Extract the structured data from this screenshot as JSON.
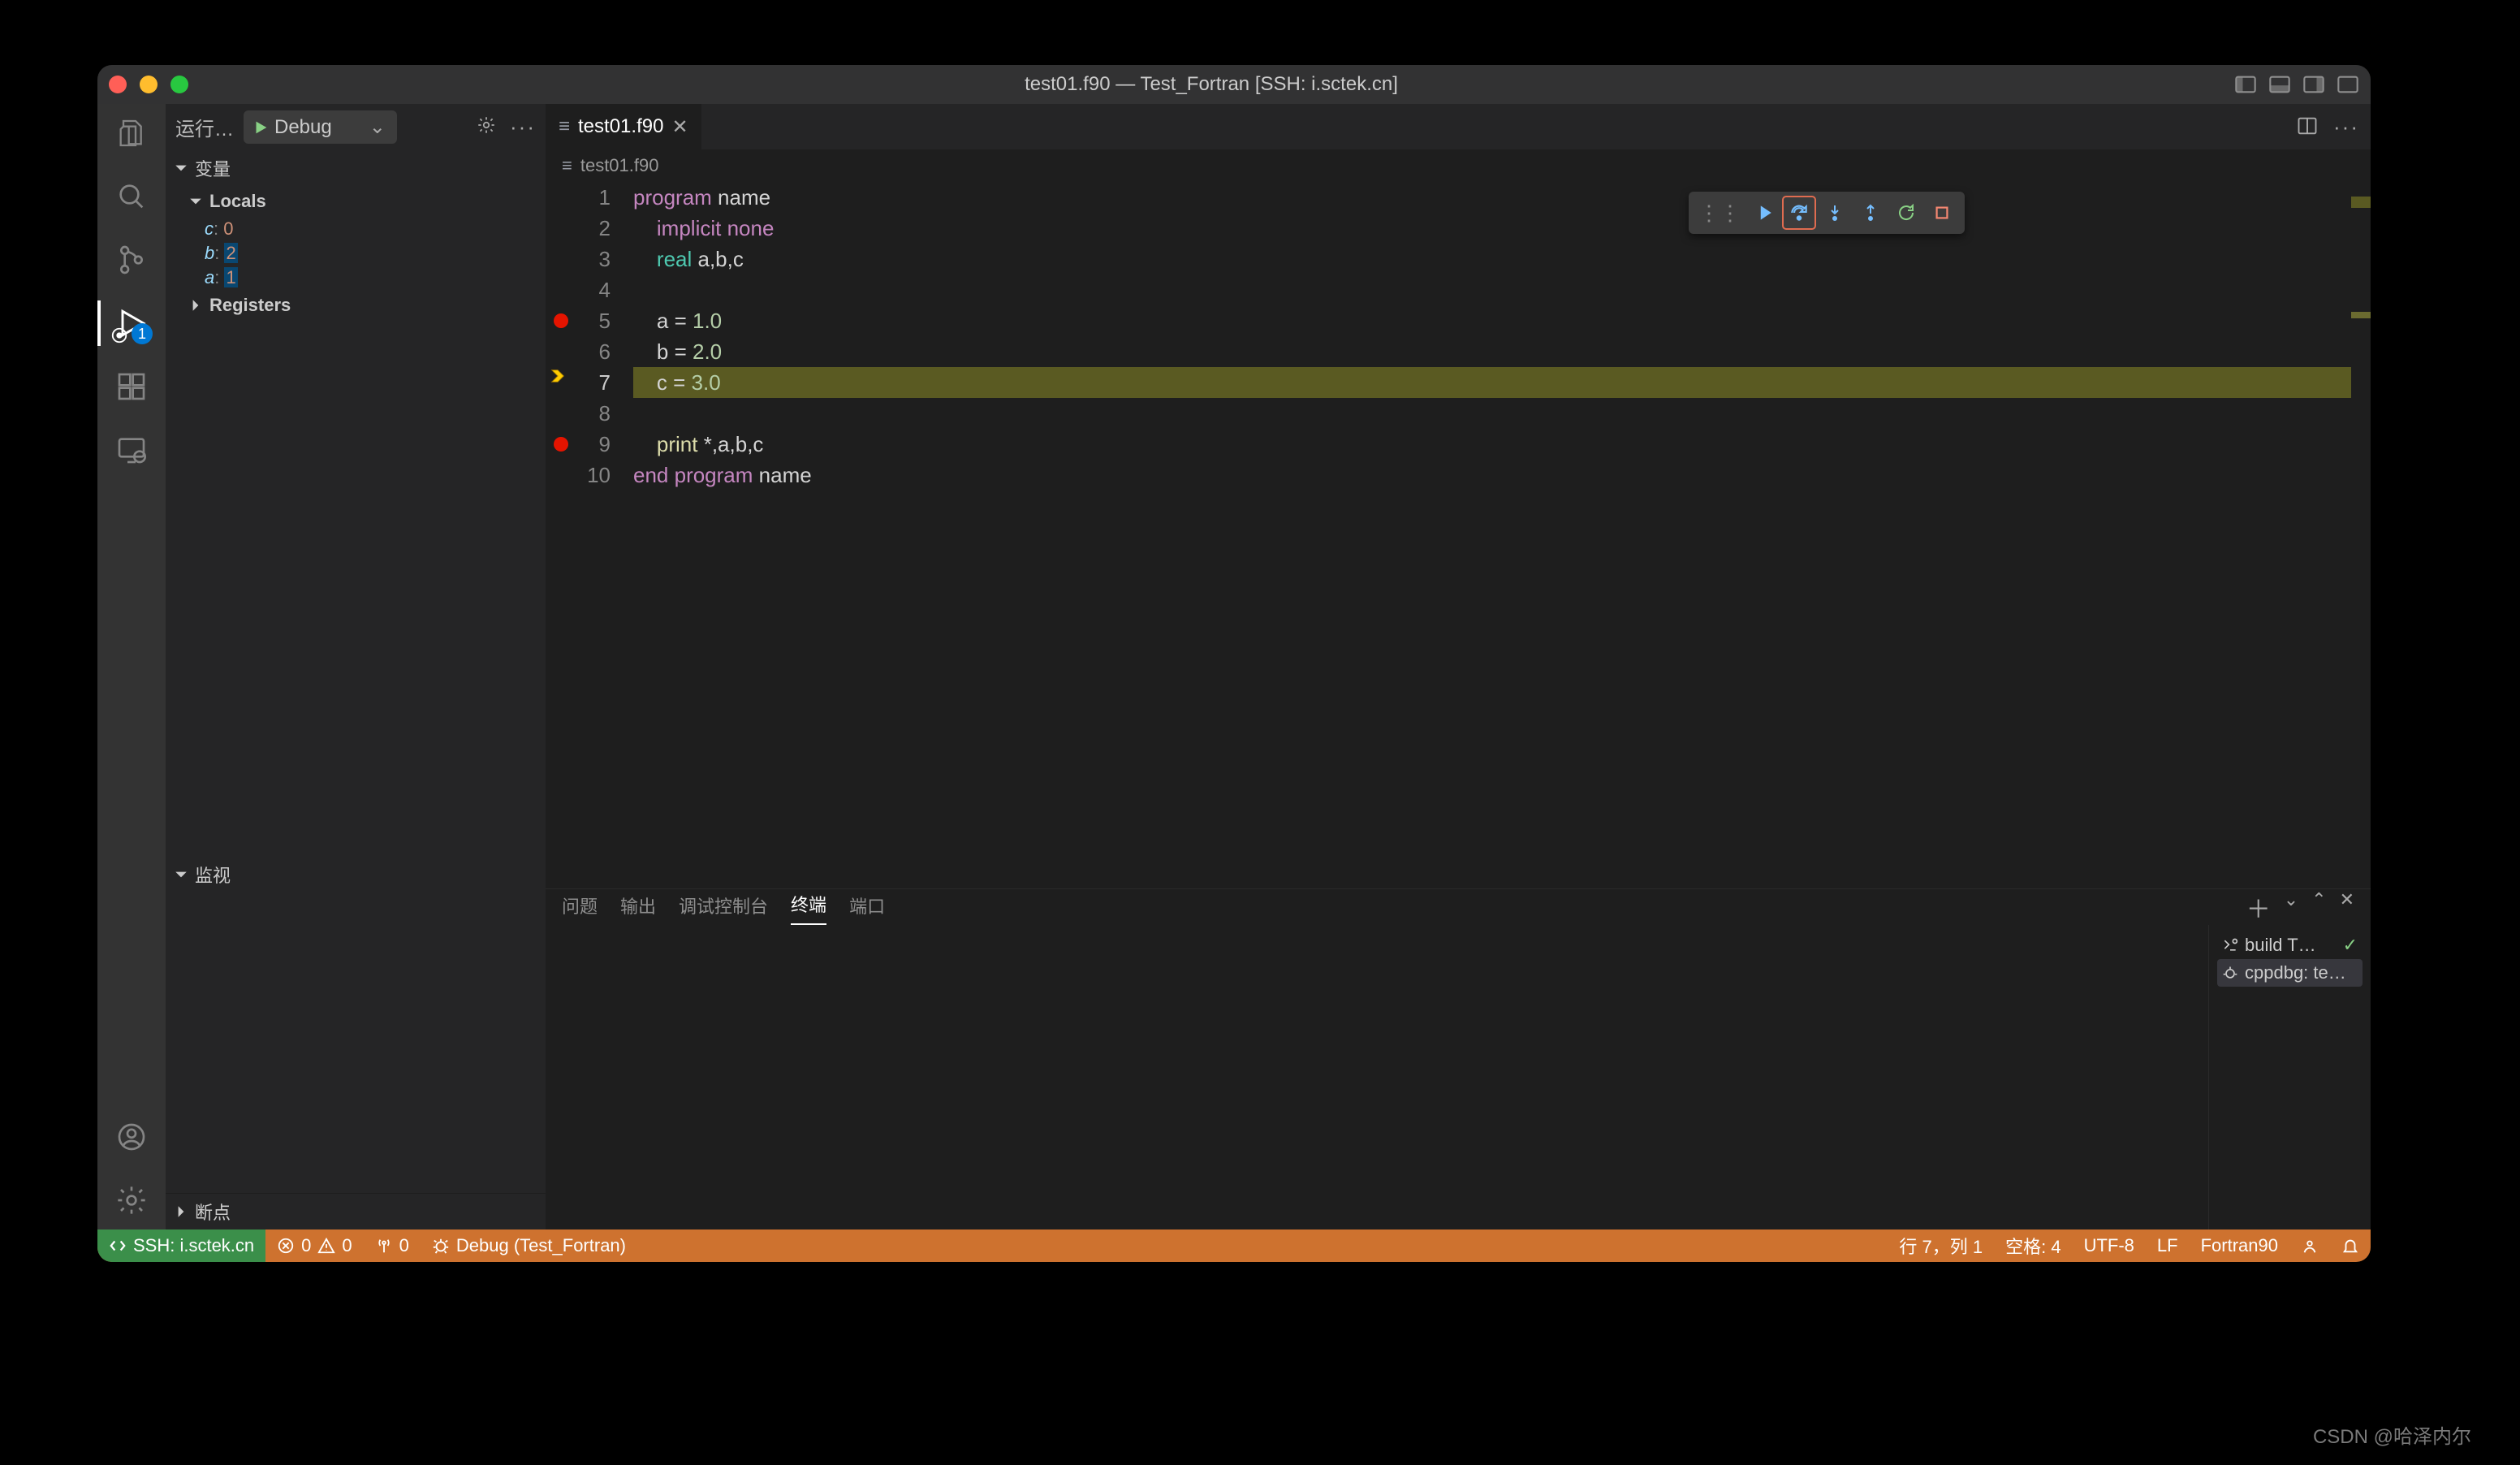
{
  "window": {
    "title": "test01.f90 — Test_Fortran [SSH: i.sctek.cn]"
  },
  "sidebar": {
    "run_label": "运行…",
    "config_name": "Debug",
    "sections": {
      "variables": "变量",
      "locals": "Locals",
      "registers": "Registers",
      "watch": "监视",
      "breakpoints": "断点"
    },
    "locals": [
      {
        "name": "c",
        "value": "0"
      },
      {
        "name": "b",
        "value": "2"
      },
      {
        "name": "a",
        "value": "1"
      }
    ]
  },
  "tab": {
    "filename": "test01.f90"
  },
  "breadcrumb": {
    "file": "test01.f90"
  },
  "editor": {
    "breakpoints": [
      5,
      9
    ],
    "current_line": 7,
    "lines": [
      [
        {
          "t": "program ",
          "c": "kw"
        },
        {
          "t": "name",
          "c": "plain"
        }
      ],
      [
        {
          "t": "    ",
          "c": "plain"
        },
        {
          "t": "implicit ",
          "c": "kw"
        },
        {
          "t": "none",
          "c": "kw"
        }
      ],
      [
        {
          "t": "    ",
          "c": "plain"
        },
        {
          "t": "real ",
          "c": "ty"
        },
        {
          "t": "a,b,c",
          "c": "plain"
        }
      ],
      [
        {
          "t": "",
          "c": "plain"
        }
      ],
      [
        {
          "t": "    ",
          "c": "plain"
        },
        {
          "t": "a = ",
          "c": "plain"
        },
        {
          "t": "1.0",
          "c": "num"
        }
      ],
      [
        {
          "t": "    ",
          "c": "plain"
        },
        {
          "t": "b = ",
          "c": "plain"
        },
        {
          "t": "2.0",
          "c": "num"
        }
      ],
      [
        {
          "t": "    ",
          "c": "plain"
        },
        {
          "t": "c = ",
          "c": "plain"
        },
        {
          "t": "3.0",
          "c": "num"
        }
      ],
      [
        {
          "t": "",
          "c": "plain"
        }
      ],
      [
        {
          "t": "    ",
          "c": "plain"
        },
        {
          "t": "print ",
          "c": "fn"
        },
        {
          "t": "*,a,b,c",
          "c": "plain"
        }
      ],
      [
        {
          "t": "end program ",
          "c": "kw"
        },
        {
          "t": "name",
          "c": "plain"
        }
      ]
    ]
  },
  "panel": {
    "tabs": {
      "problems": "问题",
      "output": "输出",
      "debug_console": "调试控制台",
      "terminal": "终端",
      "ports": "端口"
    },
    "active": "terminal",
    "terminals": [
      {
        "name": "build T…",
        "ok": true
      },
      {
        "name": "cppdbg: te…",
        "ok": false
      }
    ]
  },
  "status": {
    "remote": "SSH: i.sctek.cn",
    "errors": "0",
    "warnings": "0",
    "ports": "0",
    "debug": "Debug (Test_Fortran)",
    "line_col": "行 7，列 1",
    "spaces": "空格: 4",
    "encoding": "UTF-8",
    "eol": "LF",
    "lang": "Fortran90"
  },
  "watermark": "CSDN @哈泽内尔",
  "activity_badge": "1"
}
